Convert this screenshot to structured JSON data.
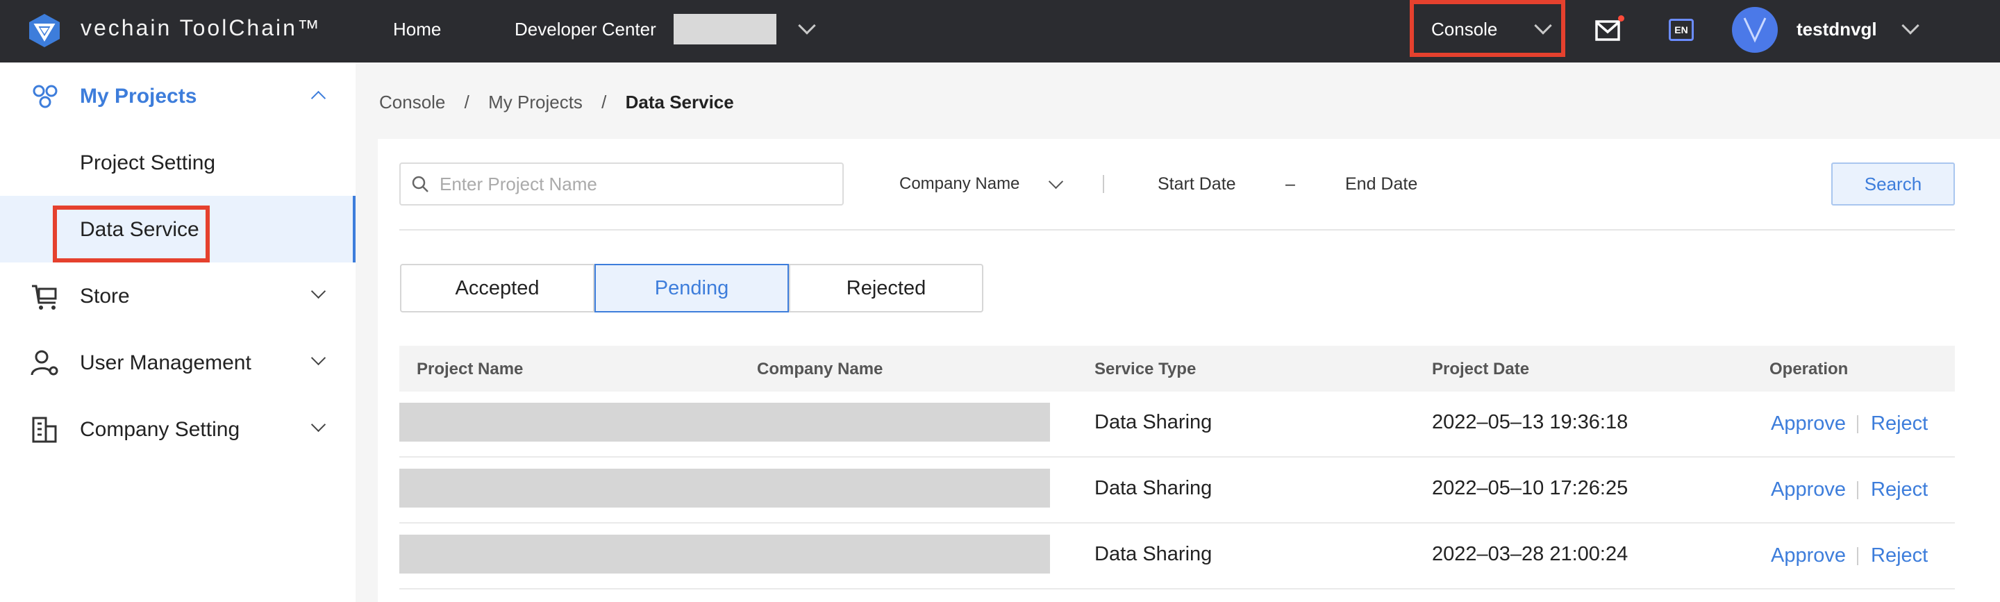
{
  "topbar": {
    "brand": "vechain ToolChain™",
    "nav": {
      "home": "Home",
      "developer_center": "Developer Center"
    },
    "console_label": "Console",
    "lang_badge": "EN",
    "username": "testdnvgl",
    "icons": [
      "logo-icon",
      "mail-icon",
      "language-icon",
      "chevron-down-icon"
    ]
  },
  "sidebar": {
    "my_projects": "My Projects",
    "project_setting": "Project Setting",
    "data_service": "Data Service",
    "store": "Store",
    "user_management": "User Management",
    "company_setting": "Company Setting"
  },
  "breadcrumb": {
    "root": "Console",
    "parent": "My Projects",
    "current": "Data Service",
    "separator": "/"
  },
  "filters": {
    "search_placeholder": "Enter Project Name",
    "company_name": "Company Name",
    "start_date": "Start Date",
    "dash": "–",
    "end_date": "End Date",
    "search_button": "Search"
  },
  "tabs": {
    "accepted": "Accepted",
    "pending": "Pending",
    "rejected": "Rejected",
    "active": "pending"
  },
  "table": {
    "headers": {
      "project_name": "Project Name",
      "company_name": "Company Name",
      "service_type": "Service Type",
      "project_date": "Project Date",
      "operation": "Operation"
    },
    "rows": [
      {
        "service_type": "Data Sharing",
        "project_date": "2022–05–13 19:36:18",
        "approve": "Approve",
        "reject": "Reject"
      },
      {
        "service_type": "Data Sharing",
        "project_date": "2022–05–10 17:26:25",
        "approve": "Approve",
        "reject": "Reject"
      },
      {
        "service_type": "Data Sharing",
        "project_date": "2022–03–28 21:00:24",
        "approve": "Approve",
        "reject": "Reject"
      }
    ]
  },
  "colors": {
    "accent": "#3d7ddb",
    "highlight": "#e5412e",
    "topbar": "#2b2c30"
  }
}
